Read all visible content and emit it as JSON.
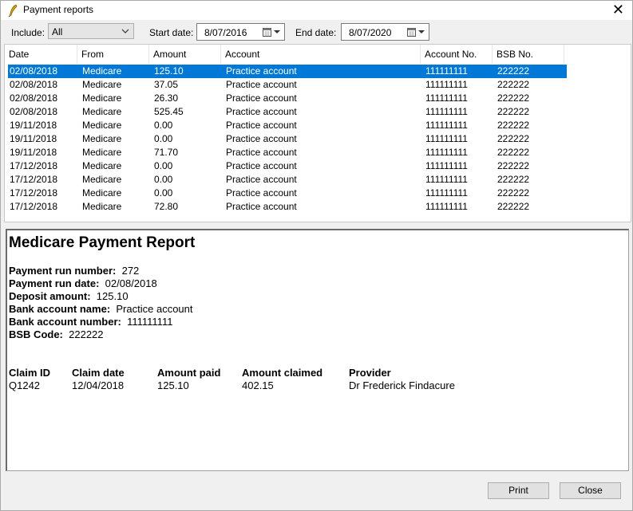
{
  "window": {
    "title": "Payment reports"
  },
  "filters": {
    "include_label": "Include:",
    "include_value": "All",
    "start_label": "Start date:",
    "start_value": "8/07/2016",
    "end_label": "End date:",
    "end_value": "8/07/2020"
  },
  "table": {
    "columns": [
      "Date",
      "From",
      "Amount",
      "Account",
      "Account No.",
      "BSB No."
    ],
    "rows": [
      [
        "02/08/2018",
        "Medicare",
        "125.10",
        "Practice account",
        "111111111",
        "222222"
      ],
      [
        "02/08/2018",
        "Medicare",
        "37.05",
        "Practice account",
        "111111111",
        "222222"
      ],
      [
        "02/08/2018",
        "Medicare",
        "26.30",
        "Practice account",
        "111111111",
        "222222"
      ],
      [
        "02/08/2018",
        "Medicare",
        "525.45",
        "Practice account",
        "111111111",
        "222222"
      ],
      [
        "19/11/2018",
        "Medicare",
        "0.00",
        "Practice account",
        "111111111",
        "222222"
      ],
      [
        "19/11/2018",
        "Medicare",
        "0.00",
        "Practice account",
        "111111111",
        "222222"
      ],
      [
        "19/11/2018",
        "Medicare",
        "71.70",
        "Practice account",
        "111111111",
        "222222"
      ],
      [
        "17/12/2018",
        "Medicare",
        "0.00",
        "Practice account",
        "111111111",
        "222222"
      ],
      [
        "17/12/2018",
        "Medicare",
        "0.00",
        "Practice account",
        "111111111",
        "222222"
      ],
      [
        "17/12/2018",
        "Medicare",
        "0.00",
        "Practice account",
        "111111111",
        "222222"
      ],
      [
        "17/12/2018",
        "Medicare",
        "72.80",
        "Practice account",
        "111111111",
        "222222"
      ]
    ],
    "selected_row": 0
  },
  "report": {
    "title": "Medicare Payment Report",
    "fields": [
      {
        "label": "Payment run number:",
        "value": "272"
      },
      {
        "label": "Payment run date:",
        "value": "02/08/2018"
      },
      {
        "label": "Deposit amount:",
        "value": "125.10"
      },
      {
        "label": "Bank account name:",
        "value": "Practice account"
      },
      {
        "label": "Bank account number:",
        "value": "111111111"
      },
      {
        "label": "BSB Code:",
        "value": "222222"
      }
    ],
    "claim_headers": [
      "Claim ID",
      "Claim date",
      "Amount paid",
      "Amount claimed",
      "Provider"
    ],
    "claim_rows": [
      [
        "Q1242",
        "12/04/2018",
        "125.10",
        "402.15",
        "Dr Frederick Findacure"
      ]
    ]
  },
  "buttons": {
    "print": "Print",
    "close": "Close"
  },
  "colors": {
    "selection": "#0078d7",
    "background": "#f0f0f0"
  }
}
